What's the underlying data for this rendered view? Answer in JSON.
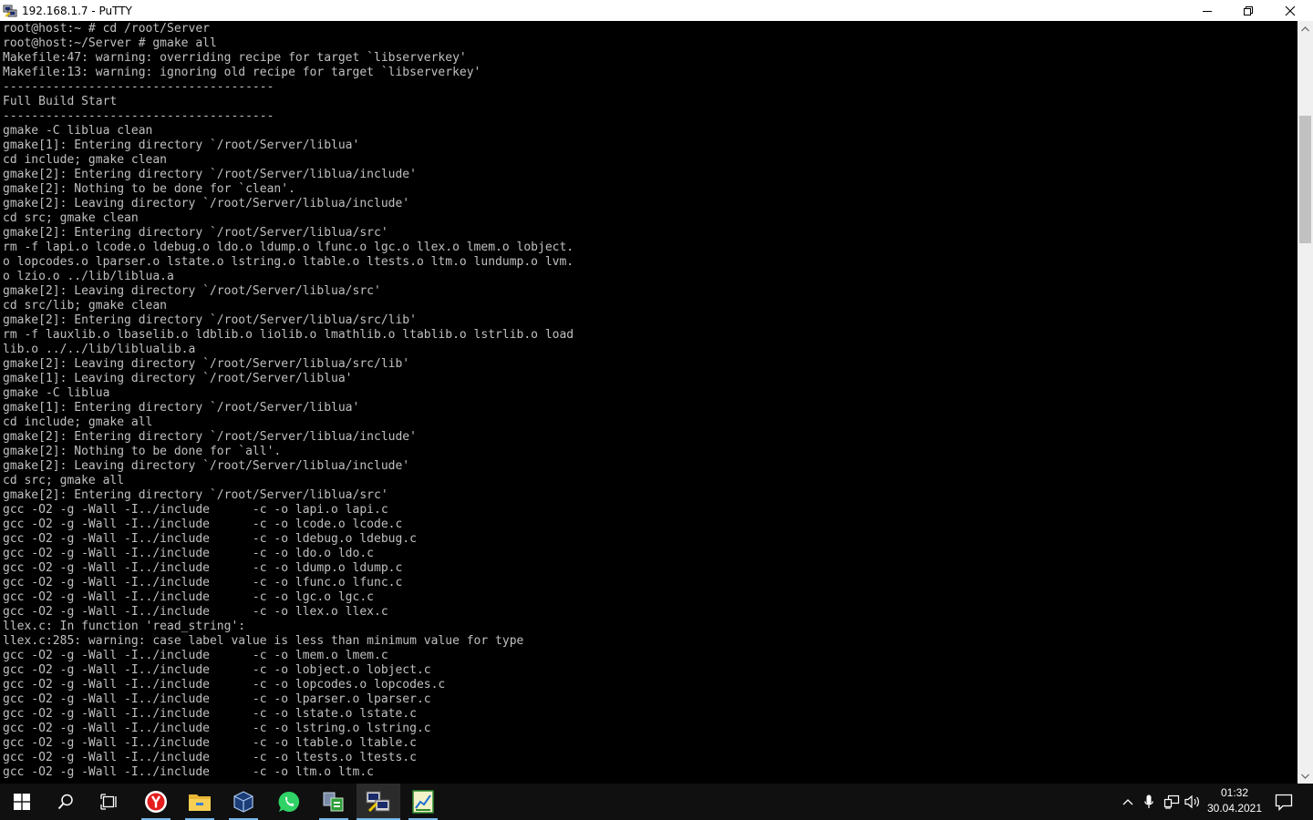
{
  "window": {
    "title": "192.168.1.7 - PuTTY",
    "icon": "putty-icon",
    "controls": [
      "minimize-icon",
      "restore-icon",
      "close-icon"
    ]
  },
  "terminal": {
    "lines": [
      "root@host:~ # cd /root/Server",
      "root@host:~/Server # gmake all",
      "Makefile:47: warning: overriding recipe for target `libserverkey'",
      "Makefile:13: warning: ignoring old recipe for target `libserverkey'",
      "--------------------------------------",
      "Full Build Start",
      "--------------------------------------",
      "gmake -C liblua clean",
      "gmake[1]: Entering directory `/root/Server/liblua'",
      "cd include; gmake clean",
      "gmake[2]: Entering directory `/root/Server/liblua/include'",
      "gmake[2]: Nothing to be done for `clean'.",
      "gmake[2]: Leaving directory `/root/Server/liblua/include'",
      "cd src; gmake clean",
      "gmake[2]: Entering directory `/root/Server/liblua/src'",
      "rm -f lapi.o lcode.o ldebug.o ldo.o ldump.o lfunc.o lgc.o llex.o lmem.o lobject.",
      "o lopcodes.o lparser.o lstate.o lstring.o ltable.o ltests.o ltm.o lundump.o lvm.",
      "o lzio.o ../lib/liblua.a",
      "gmake[2]: Leaving directory `/root/Server/liblua/src'",
      "cd src/lib; gmake clean",
      "gmake[2]: Entering directory `/root/Server/liblua/src/lib'",
      "rm -f lauxlib.o lbaselib.o ldblib.o liolib.o lmathlib.o ltablib.o lstrlib.o load",
      "lib.o ../../lib/liblualib.a",
      "gmake[2]: Leaving directory `/root/Server/liblua/src/lib'",
      "gmake[1]: Leaving directory `/root/Server/liblua'",
      "gmake -C liblua",
      "gmake[1]: Entering directory `/root/Server/liblua'",
      "cd include; gmake all",
      "gmake[2]: Entering directory `/root/Server/liblua/include'",
      "gmake[2]: Nothing to be done for `all'.",
      "gmake[2]: Leaving directory `/root/Server/liblua/include'",
      "cd src; gmake all",
      "gmake[2]: Entering directory `/root/Server/liblua/src'",
      "gcc -O2 -g -Wall -I../include      -c -o lapi.o lapi.c",
      "gcc -O2 -g -Wall -I../include      -c -o lcode.o lcode.c",
      "gcc -O2 -g -Wall -I../include      -c -o ldebug.o ldebug.c",
      "gcc -O2 -g -Wall -I../include      -c -o ldo.o ldo.c",
      "gcc -O2 -g -Wall -I../include      -c -o ldump.o ldump.c",
      "gcc -O2 -g -Wall -I../include      -c -o lfunc.o lfunc.c",
      "gcc -O2 -g -Wall -I../include      -c -o lgc.o lgc.c",
      "gcc -O2 -g -Wall -I../include      -c -o llex.o llex.c",
      "llex.c: In function 'read_string':",
      "llex.c:285: warning: case label value is less than minimum value for type",
      "gcc -O2 -g -Wall -I../include      -c -o lmem.o lmem.c",
      "gcc -O2 -g -Wall -I../include      -c -o lobject.o lobject.c",
      "gcc -O2 -g -Wall -I../include      -c -o lopcodes.o lopcodes.c",
      "gcc -O2 -g -Wall -I../include      -c -o lparser.o lparser.c",
      "gcc -O2 -g -Wall -I../include      -c -o lstate.o lstate.c",
      "gcc -O2 -g -Wall -I../include      -c -o lstring.o lstring.c",
      "gcc -O2 -g -Wall -I../include      -c -o ltable.o ltable.c",
      "gcc -O2 -g -Wall -I../include      -c -o ltests.o ltests.c",
      "gcc -O2 -g -Wall -I../include      -c -o ltm.o ltm.c"
    ],
    "text_color": "#c0c0c0",
    "background": "#000000"
  },
  "taskbar": {
    "items": [
      {
        "name": "start-button",
        "icon": "windows-logo-icon"
      },
      {
        "name": "search-button",
        "icon": "search-icon"
      },
      {
        "name": "task-view-button",
        "icon": "task-view-icon"
      },
      {
        "name": "taskbar-app-yandex-browser",
        "icon": "yandex-browser-icon",
        "running": true
      },
      {
        "name": "taskbar-app-file-explorer",
        "icon": "folder-icon",
        "running": true
      },
      {
        "name": "taskbar-app-virtualbox",
        "icon": "virtualbox-icon",
        "running": true
      },
      {
        "name": "taskbar-app-whatsapp",
        "icon": "whatsapp-icon",
        "running": false
      },
      {
        "name": "taskbar-app-copy-tool",
        "icon": "copy-tool-icon",
        "running": true
      },
      {
        "name": "taskbar-app-putty",
        "icon": "putty-icon",
        "running": true,
        "active": true
      },
      {
        "name": "taskbar-app-chart-tool",
        "icon": "chart-app-icon",
        "running": true
      }
    ],
    "tray": [
      "chevron-up-icon",
      "microphone-icon",
      "network-icon",
      "volume-icon"
    ],
    "clock": {
      "time": "01:32",
      "date": "30.04.2021"
    },
    "notification_icon": "action-center-icon",
    "accent": "#76b9ed"
  }
}
